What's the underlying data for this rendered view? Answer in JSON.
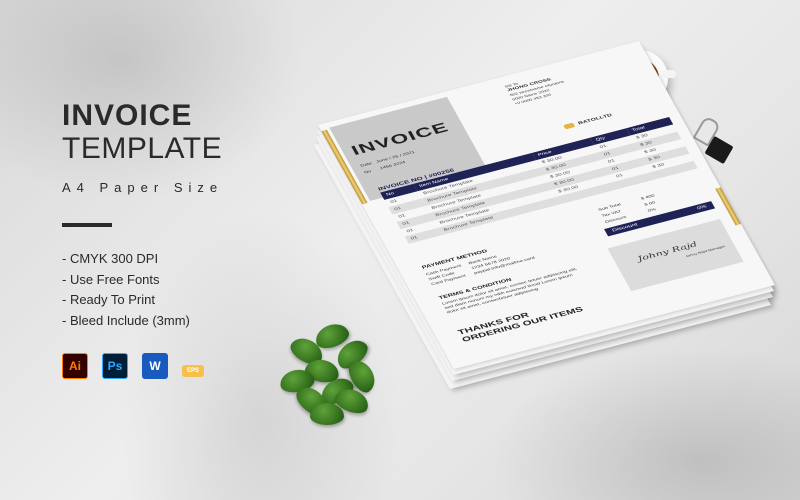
{
  "title": {
    "line1": "INVOICE",
    "line2": "TEMPLATE",
    "subtitle": "A4 Paper Size"
  },
  "features": [
    "- CMYK 300 DPI",
    "- Use Free Fonts",
    "- Ready To Print",
    "- Bleed Include (3mm)"
  ],
  "software_icons": [
    {
      "label": "Ai",
      "name": "illustrator-icon"
    },
    {
      "label": "Ps",
      "name": "photoshop-icon"
    },
    {
      "label": "W",
      "name": "word-icon"
    },
    {
      "label": "EPS",
      "name": "eps-icon"
    }
  ],
  "colors": {
    "navy": "#1f2255",
    "gold": "#d4af4a"
  },
  "invoice": {
    "heading": "INVOICE",
    "date_label": "Date",
    "date": "June / 25 / 2021",
    "no_label": "No",
    "no": "1456 3224",
    "bill_to_label": "Bill To",
    "bill_to_name": "JHONG CROSS",
    "bill_to_lines": [
      "502 streetname cityname",
      "0000 Name 2020",
      "+0 0000 453 300"
    ],
    "company": "BATOLLTD",
    "invoice_no": "INVOICE NO | #00256",
    "columns": [
      "No",
      "Item Name",
      "Price",
      "Qty",
      "Total"
    ],
    "rows": [
      [
        "01",
        "Brochure Template",
        "$ 30.00",
        "01",
        "$ 30"
      ],
      [
        "01",
        "Brochure Template",
        "$ 30.00",
        "01",
        "$ 30"
      ],
      [
        "01",
        "Brochure Template",
        "$ 30.00",
        "01",
        "$ 30"
      ],
      [
        "01",
        "Brochure Template",
        "$ 30.00",
        "01",
        "$ 30"
      ],
      [
        "01",
        "Brochure Template",
        "$ 30.00",
        "01",
        "$ 30"
      ],
      [
        "01",
        "Brochure Template",
        "",
        "",
        ""
      ]
    ],
    "totals": [
      {
        "label": "Sub Total",
        "value": "$ 400"
      },
      {
        "label": "Tax VAT",
        "value": "$ 00"
      },
      {
        "label": "Discount",
        "value": "0%"
      }
    ],
    "discount_bar": {
      "label": "Discount",
      "value": "0%"
    },
    "signature": "Johny Rajd",
    "signer": "Johny Rajd Manager",
    "payment_heading": "PAYMENT METHOD",
    "payment": [
      [
        "Cash Payment",
        "Bank Name"
      ],
      [
        "Swift Code",
        "1234 5678 2020"
      ],
      [
        "Card Payment",
        "paypal.info@mailme.card"
      ]
    ],
    "terms_heading": "TERMS & CONDITION",
    "terms_text": "Lorem ipsum dolor sit amet, consec tetuer adipiscing elit, sed diam nonum my nibh euismod tincid Lorem ipsum dolor sit amet, consectetuer adipiscing",
    "thanks_line1": "THANKS FOR",
    "thanks_line2": "ORDERING OUR ITEMS"
  }
}
